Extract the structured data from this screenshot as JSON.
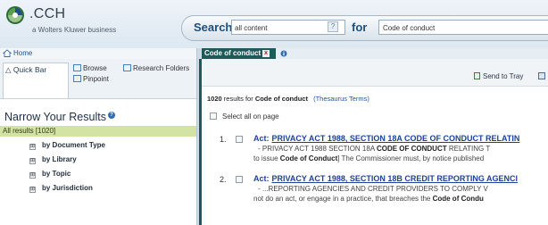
{
  "brand": {
    "name": ".CCH",
    "tagline": "a Wolters Kluwer business",
    "colors": {
      "navy": "#1d4f7d",
      "teal": "#1e5a5a",
      "green_row": "#d3e3a3",
      "link": "#1f3f99"
    }
  },
  "search": {
    "label": "Search",
    "scope_value": "all content",
    "for_label": "for",
    "query_value": "Code of conduct"
  },
  "left": {
    "home_label": "Home",
    "tabs": [
      {
        "label": "△ Quick Bar",
        "icon": ""
      },
      {
        "label": "Browse",
        "icon": "browse-icon"
      },
      {
        "label": "Research Folders",
        "icon": "folder-icon"
      },
      {
        "label": "Pinpoint",
        "icon": "pinpoint-icon"
      }
    ],
    "narrow_title": "Narrow Your Results",
    "all_results": "All results [1020]",
    "facets": [
      {
        "expand": "⊞",
        "label": "by Document Type"
      },
      {
        "expand": "⊞",
        "label": "by Library"
      },
      {
        "expand": "⊞",
        "label": "by Topic"
      },
      {
        "expand": "⊞",
        "label": "by Jurisdiction"
      }
    ]
  },
  "main": {
    "tab_label": "Code of conduct",
    "tab_close": "x",
    "send_to_tray": "Send to Tray",
    "results_count": "1020",
    "results_for": "results for",
    "results_query": "Code of conduct",
    "thesaurus": "(Thesaurus Terms)",
    "select_all": "Select all on page",
    "results": [
      {
        "number": "1.",
        "act": "Act:",
        "title": "PRIVACY ACT 1988, SECTION 18A CODE OF CONDUCT RELATIN",
        "line1_pre": "- PRIVACY ACT 1988 SECTION 18A ",
        "line1_hl": "CODE OF CONDUCT",
        "line1_post": " RELATING T",
        "line2_pre": "to issue ",
        "line2_hl": "Code of Conduct",
        "line2_post": "] The Commissioner must, by notice published"
      },
      {
        "number": "2.",
        "act": "Act:",
        "title": "PRIVACY ACT 1988, SECTION 18B CREDIT REPORTING AGENCI",
        "line1_pre": "- ...REPORTING AGENCIES AND CREDIT PROVIDERS TO COMPLY V",
        "line1_hl": "",
        "line1_post": "",
        "line2_pre": "not do an act, or engage in a practice, that breaches the ",
        "line2_hl": "Code of Condu",
        "line2_post": ""
      }
    ]
  }
}
